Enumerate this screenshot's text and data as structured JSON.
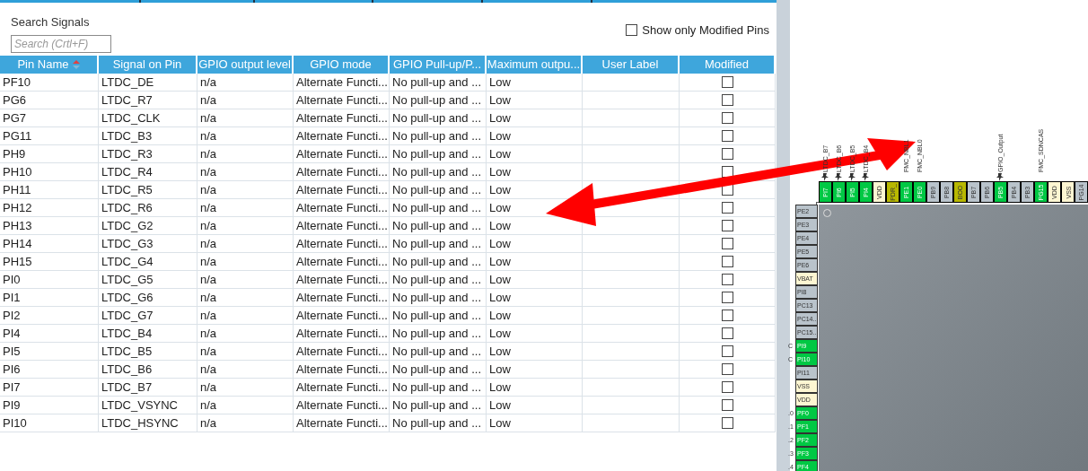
{
  "search": {
    "title": "Search Signals",
    "placeholder": "Search (Crtl+F)"
  },
  "filter": {
    "label": "Show only Modified Pins",
    "checked": false
  },
  "table": {
    "columns": [
      "Pin Name",
      "Signal on Pin",
      "GPIO output level",
      "GPIO mode",
      "GPIO Pull-up/P...",
      "Maximum outpu...",
      "User Label",
      "Modified"
    ],
    "rows": [
      {
        "pin": "PF10",
        "signal": "LTDC_DE",
        "level": "n/a",
        "mode": "Alternate Functi...",
        "pull": "No pull-up and ...",
        "speed": "Low",
        "label": "",
        "modified": false
      },
      {
        "pin": "PG6",
        "signal": "LTDC_R7",
        "level": "n/a",
        "mode": "Alternate Functi...",
        "pull": "No pull-up and ...",
        "speed": "Low",
        "label": "",
        "modified": false
      },
      {
        "pin": "PG7",
        "signal": "LTDC_CLK",
        "level": "n/a",
        "mode": "Alternate Functi...",
        "pull": "No pull-up and ...",
        "speed": "Low",
        "label": "",
        "modified": false
      },
      {
        "pin": "PG11",
        "signal": "LTDC_B3",
        "level": "n/a",
        "mode": "Alternate Functi...",
        "pull": "No pull-up and ...",
        "speed": "Low",
        "label": "",
        "modified": false
      },
      {
        "pin": "PH9",
        "signal": "LTDC_R3",
        "level": "n/a",
        "mode": "Alternate Functi...",
        "pull": "No pull-up and ...",
        "speed": "Low",
        "label": "",
        "modified": false
      },
      {
        "pin": "PH10",
        "signal": "LTDC_R4",
        "level": "n/a",
        "mode": "Alternate Functi...",
        "pull": "No pull-up and ...",
        "speed": "Low",
        "label": "",
        "modified": false
      },
      {
        "pin": "PH11",
        "signal": "LTDC_R5",
        "level": "n/a",
        "mode": "Alternate Functi...",
        "pull": "No pull-up and ...",
        "speed": "Low",
        "label": "",
        "modified": false
      },
      {
        "pin": "PH12",
        "signal": "LTDC_R6",
        "level": "n/a",
        "mode": "Alternate Functi...",
        "pull": "No pull-up and ...",
        "speed": "Low",
        "label": "",
        "modified": false
      },
      {
        "pin": "PH13",
        "signal": "LTDC_G2",
        "level": "n/a",
        "mode": "Alternate Functi...",
        "pull": "No pull-up and ...",
        "speed": "Low",
        "label": "",
        "modified": false
      },
      {
        "pin": "PH14",
        "signal": "LTDC_G3",
        "level": "n/a",
        "mode": "Alternate Functi...",
        "pull": "No pull-up and ...",
        "speed": "Low",
        "label": "",
        "modified": false
      },
      {
        "pin": "PH15",
        "signal": "LTDC_G4",
        "level": "n/a",
        "mode": "Alternate Functi...",
        "pull": "No pull-up and ...",
        "speed": "Low",
        "label": "",
        "modified": false
      },
      {
        "pin": "PI0",
        "signal": "LTDC_G5",
        "level": "n/a",
        "mode": "Alternate Functi...",
        "pull": "No pull-up and ...",
        "speed": "Low",
        "label": "",
        "modified": false
      },
      {
        "pin": "PI1",
        "signal": "LTDC_G6",
        "level": "n/a",
        "mode": "Alternate Functi...",
        "pull": "No pull-up and ...",
        "speed": "Low",
        "label": "",
        "modified": false
      },
      {
        "pin": "PI2",
        "signal": "LTDC_G7",
        "level": "n/a",
        "mode": "Alternate Functi...",
        "pull": "No pull-up and ...",
        "speed": "Low",
        "label": "",
        "modified": false
      },
      {
        "pin": "PI4",
        "signal": "LTDC_B4",
        "level": "n/a",
        "mode": "Alternate Functi...",
        "pull": "No pull-up and ...",
        "speed": "Low",
        "label": "",
        "modified": false
      },
      {
        "pin": "PI5",
        "signal": "LTDC_B5",
        "level": "n/a",
        "mode": "Alternate Functi...",
        "pull": "No pull-up and ...",
        "speed": "Low",
        "label": "",
        "modified": false
      },
      {
        "pin": "PI6",
        "signal": "LTDC_B6",
        "level": "n/a",
        "mode": "Alternate Functi...",
        "pull": "No pull-up and ...",
        "speed": "Low",
        "label": "",
        "modified": false
      },
      {
        "pin": "PI7",
        "signal": "LTDC_B7",
        "level": "n/a",
        "mode": "Alternate Functi...",
        "pull": "No pull-up and ...",
        "speed": "Low",
        "label": "",
        "modified": false
      },
      {
        "pin": "PI9",
        "signal": "LTDC_VSYNC",
        "level": "n/a",
        "mode": "Alternate Functi...",
        "pull": "No pull-up and ...",
        "speed": "Low",
        "label": "",
        "modified": false
      },
      {
        "pin": "PI10",
        "signal": "LTDC_HSYNC",
        "level": "n/a",
        "mode": "Alternate Functi...",
        "pull": "No pull-up and ...",
        "speed": "Low",
        "label": "",
        "modified": false
      }
    ]
  },
  "chip": {
    "top_pins": [
      {
        "name": "PI7",
        "kind": "assigned",
        "signal": "LTDC_B7",
        "pinned": true
      },
      {
        "name": "PI6",
        "kind": "assigned",
        "signal": "LTDC_B6",
        "pinned": true
      },
      {
        "name": "PI5",
        "kind": "assigned",
        "signal": "LTDC_B5",
        "pinned": true
      },
      {
        "name": "PI4",
        "kind": "assigned",
        "signal": "LTDC_B4",
        "pinned": true
      },
      {
        "name": "VDD",
        "kind": "power",
        "pinned": false
      },
      {
        "name": "PDR_",
        "kind": "reset",
        "pinned": false
      },
      {
        "name": "PE1",
        "kind": "assigned",
        "signal": "FMC_NBL1",
        "pinned": false
      },
      {
        "name": "PE0",
        "kind": "assigned",
        "signal": "FMC_NBL0",
        "pinned": false
      },
      {
        "name": "PB9",
        "kind": "free",
        "pinned": false
      },
      {
        "name": "PB8",
        "kind": "free",
        "pinned": false
      },
      {
        "name": "BOO",
        "kind": "reset",
        "pinned": false
      },
      {
        "name": "PB7",
        "kind": "free",
        "pinned": false
      },
      {
        "name": "PB6",
        "kind": "free",
        "pinned": false
      },
      {
        "name": "PB5",
        "kind": "assigned",
        "signal": "GPIO_Output",
        "pinned": true
      },
      {
        "name": "PB4",
        "kind": "free",
        "pinned": false
      },
      {
        "name": "PB3",
        "kind": "free",
        "pinned": false
      },
      {
        "name": "PG15",
        "kind": "assigned",
        "signal": "FMC_SDNCAS",
        "pinned": false
      },
      {
        "name": "VDD",
        "kind": "power",
        "pinned": false
      },
      {
        "name": "VSS",
        "kind": "power",
        "pinned": false
      },
      {
        "name": "PG14",
        "kind": "free",
        "pinned": false
      }
    ],
    "left_pins": [
      {
        "name": "PE2",
        "kind": "free"
      },
      {
        "name": "PE3",
        "kind": "free"
      },
      {
        "name": "PE4",
        "kind": "free"
      },
      {
        "name": "PE5",
        "kind": "free"
      },
      {
        "name": "PE6",
        "kind": "free"
      },
      {
        "name": "VBAT",
        "kind": "power"
      },
      {
        "name": "PI8",
        "kind": "free"
      },
      {
        "name": "PC13",
        "kind": "free"
      },
      {
        "name": "PC14...",
        "kind": "free"
      },
      {
        "name": "PC15...",
        "kind": "free"
      },
      {
        "name": "PI9",
        "kind": "assigned",
        "signal": "C"
      },
      {
        "name": "PI10",
        "kind": "assigned",
        "signal": "C"
      },
      {
        "name": "PI11",
        "kind": "free"
      },
      {
        "name": "VSS",
        "kind": "power"
      },
      {
        "name": "VDD",
        "kind": "power"
      },
      {
        "name": "PF0",
        "kind": "assigned",
        "signal": ".0"
      },
      {
        "name": "PF1",
        "kind": "assigned",
        "signal": ".1"
      },
      {
        "name": "PF2",
        "kind": "assigned",
        "signal": ".2"
      },
      {
        "name": "PF3",
        "kind": "assigned",
        "signal": ".3"
      },
      {
        "name": "PF4",
        "kind": "assigned",
        "signal": ".4"
      }
    ]
  }
}
